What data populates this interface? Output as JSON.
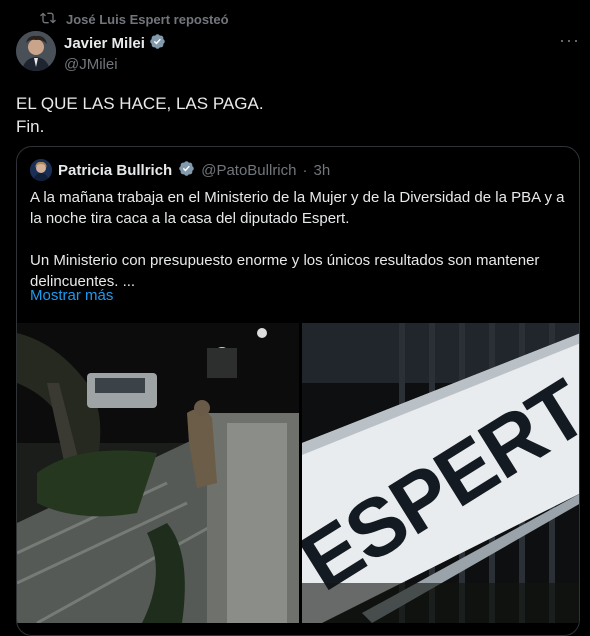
{
  "repost": {
    "text": "José Luis Espert reposteó"
  },
  "tweet": {
    "author_name": "Javier Milei",
    "author_handle": "@JMilei",
    "lines": [
      "EL QUE LAS HACE, LAS PAGA.",
      "Fin."
    ]
  },
  "quote": {
    "author_name": "Patricia Bullrich",
    "author_handle": "@PatoBullrich",
    "separator": "·",
    "time": "3h",
    "paragraph1": "A la mañana trabaja en el Ministerio de la Mujer y de la Diversidad de la PBA y a la noche tira caca a la casa del diputado Espert.",
    "paragraph2": "Un Ministerio con presupuesto enorme y los únicos resultados son mantener delincuentes. ...",
    "show_more": "Mostrar más"
  },
  "media": {
    "banner_text": "ESPERT"
  },
  "icons": {
    "repost": "repost-icon",
    "verified": "verified-badge-icon",
    "more": "more-options-icon"
  },
  "colors": {
    "background": "#000000",
    "text": "#e7e9ea",
    "muted": "#71767b",
    "link": "#1d9bf0",
    "border": "#2f3336"
  }
}
